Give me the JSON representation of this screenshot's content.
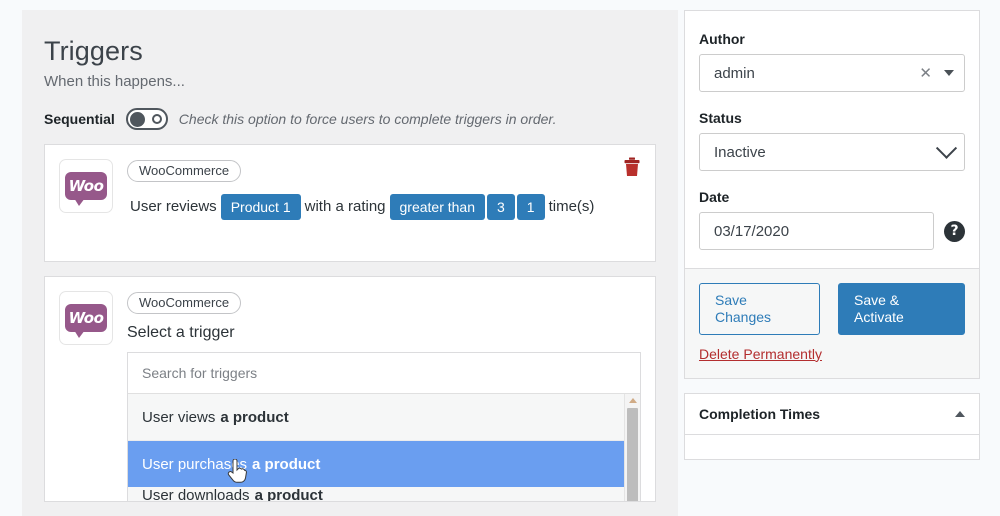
{
  "main": {
    "title": "Triggers",
    "subtitle": "When this happens...",
    "sequential": {
      "label": "Sequential",
      "description": "Check this option to force users to complete triggers in order.",
      "state": "off"
    },
    "triggers": [
      {
        "integration_badge": "WooCommerce",
        "icon": "woocommerce-icon",
        "logo_text": "Woo",
        "delete_icon": "trash-icon",
        "sentence": [
          {
            "type": "text",
            "value": "User reviews"
          },
          {
            "type": "token",
            "value": "Product 1"
          },
          {
            "type": "text",
            "value": "with a rating"
          },
          {
            "type": "token",
            "value": "greater than"
          },
          {
            "type": "token",
            "value": "3"
          },
          {
            "type": "token",
            "value": "1"
          },
          {
            "type": "text",
            "value": "time(s)"
          }
        ]
      },
      {
        "integration_badge": "WooCommerce",
        "icon": "woocommerce-icon",
        "logo_text": "Woo",
        "heading": "Select a trigger",
        "search_placeholder": "Search for triggers",
        "options": [
          {
            "prefix": "User views",
            "bold": "a product",
            "selected": false
          },
          {
            "prefix": "User purchases",
            "bold": "a product",
            "selected": true
          },
          {
            "prefix": "User downloads",
            "bold": "a product",
            "selected": false
          }
        ]
      }
    ]
  },
  "sidebar": {
    "author": {
      "label": "Author",
      "value": "admin",
      "clear_icon": "close-icon",
      "dropdown_icon": "caret-down-icon"
    },
    "status": {
      "label": "Status",
      "value": "Inactive",
      "dropdown_icon": "chevron-down-icon"
    },
    "date": {
      "label": "Date",
      "value": "03/17/2020",
      "help_icon": "help-icon",
      "help_glyph": "?"
    },
    "actions": {
      "save_changes": "Save Changes",
      "save_activate": "Save & Activate",
      "delete": "Delete Permanently"
    },
    "completion_times": {
      "title": "Completion Times",
      "toggle_icon": "caret-up-icon"
    }
  },
  "colors": {
    "accent_blue": "#2e7cb8",
    "highlight_blue": "#6a9ef0",
    "woo_purple": "#96588a",
    "danger_red": "#b32d2e",
    "panel_gray": "#f0f0f1"
  }
}
